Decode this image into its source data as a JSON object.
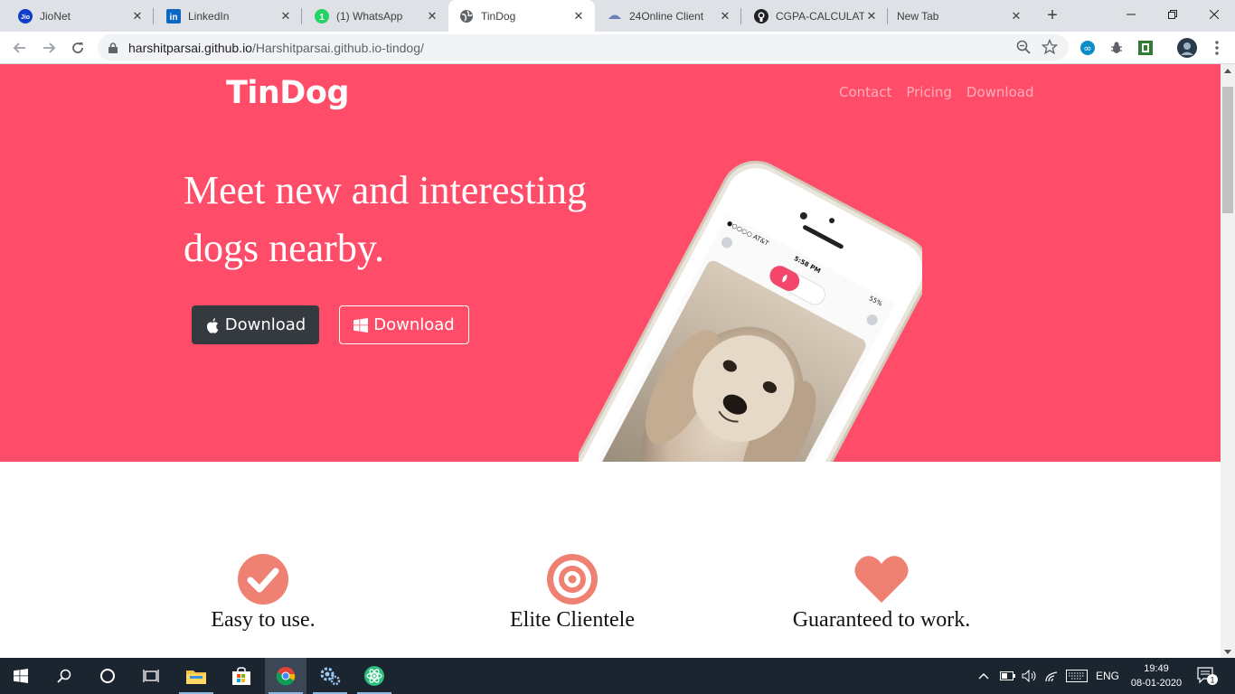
{
  "browser": {
    "tabs": [
      {
        "title": "JioNet",
        "favicon": "jio-icon"
      },
      {
        "title": "LinkedIn",
        "favicon": "linkedin-icon"
      },
      {
        "title": "(1) WhatsApp",
        "favicon": "whatsapp-icon",
        "badge": "1"
      },
      {
        "title": "TinDog",
        "favicon": "globe-icon",
        "active": true
      },
      {
        "title": "24Online Client",
        "favicon": "24online-icon"
      },
      {
        "title": "CGPA-CALCULATOR",
        "favicon": "github-icon"
      },
      {
        "title": "New Tab",
        "favicon": ""
      }
    ],
    "url": {
      "host": "harshitparsai.github.io",
      "path": "/Harshitparsai.github.io-tindog/"
    }
  },
  "site": {
    "brand": "TinDog",
    "nav": [
      "Contact",
      "Pricing",
      "Download"
    ],
    "headline": "Meet new and interesting dogs nearby.",
    "download_apple": "Download",
    "download_windows": "Download",
    "phone_screen": {
      "carrier": "●○○○○ AT&T",
      "time": "5:58 PM",
      "battery": "55%"
    },
    "features": [
      {
        "title": "Easy to use.",
        "icon": "check-circle-icon"
      },
      {
        "title": "Elite Clientele",
        "icon": "bullseye-icon"
      },
      {
        "title": "Guaranteed to work.",
        "icon": "heart-icon"
      }
    ],
    "colors": {
      "hero": "#ff4c68",
      "feature_icon": "#ef8172",
      "dark_button": "#343a40"
    }
  },
  "taskbar": {
    "lang": "ENG",
    "time": "19:49",
    "date": "08-01-2020",
    "notifications": "1"
  }
}
